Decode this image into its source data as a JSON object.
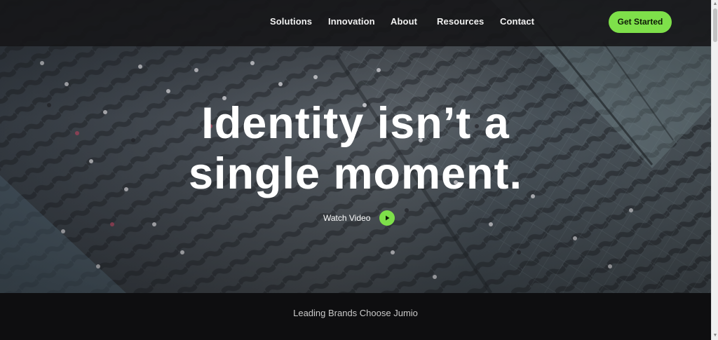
{
  "nav": {
    "items": [
      {
        "label": "Solutions"
      },
      {
        "label": "Innovation"
      },
      {
        "label": "About"
      },
      {
        "label": "Resources"
      },
      {
        "label": "Contact"
      }
    ],
    "cta_label": "Get Started"
  },
  "hero": {
    "headline_line1": "Identity isn’t a",
    "headline_line2": "single moment.",
    "watch_video_label": "Watch Video",
    "play_icon": "play-icon"
  },
  "brands": {
    "heading": "Leading Brands Choose Jumio"
  },
  "colors": {
    "accent": "#7ee04a",
    "topbar": "#161618",
    "band": "#0e0e10"
  }
}
